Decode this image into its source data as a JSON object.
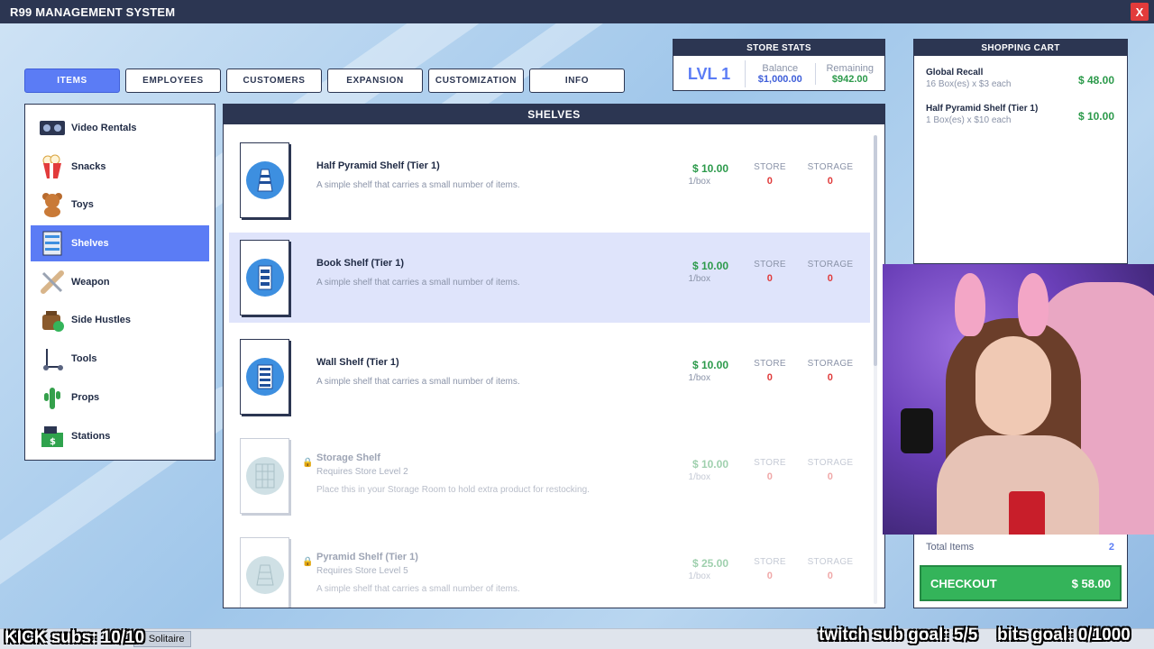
{
  "window": {
    "title": "R99 MANAGEMENT SYSTEM",
    "close_label": "X"
  },
  "tabs": [
    {
      "label": "ITEMS",
      "active": true
    },
    {
      "label": "EMPLOYEES",
      "active": false
    },
    {
      "label": "CUSTOMERS",
      "active": false
    },
    {
      "label": "EXPANSION",
      "active": false
    },
    {
      "label": "CUSTOMIZATION",
      "active": false
    },
    {
      "label": "INFO",
      "active": false
    }
  ],
  "store_stats": {
    "header": "STORE STATS",
    "level": "LVL 1",
    "balance_label": "Balance",
    "balance_value": "$1,000.00",
    "remaining_label": "Remaining",
    "remaining_value": "$942.00"
  },
  "sidebar": {
    "items": [
      {
        "label": "Video Rentals",
        "icon": "video-tape-icon"
      },
      {
        "label": "Snacks",
        "icon": "popcorn-icon"
      },
      {
        "label": "Toys",
        "icon": "teddy-bear-icon"
      },
      {
        "label": "Shelves",
        "icon": "shelf-icon",
        "active": true
      },
      {
        "label": "Weapon",
        "icon": "bat-icon"
      },
      {
        "label": "Side Hustles",
        "icon": "money-bag-icon"
      },
      {
        "label": "Tools",
        "icon": "scooter-icon"
      },
      {
        "label": "Props",
        "icon": "cactus-icon"
      },
      {
        "label": "Stations",
        "icon": "cash-register-icon"
      }
    ]
  },
  "panel": {
    "header": "SHELVES",
    "store_label": "STORE",
    "storage_label": "STORAGE",
    "items": [
      {
        "name": "Half Pyramid Shelf (Tier 1)",
        "desc": "A simple shelf that carries a small number of items.",
        "price": "$ 10.00",
        "unit": "1/box",
        "store": "0",
        "storage": "0",
        "locked": false
      },
      {
        "name": "Book Shelf (Tier 1)",
        "desc": "A simple shelf that carries a small number of items.",
        "price": "$ 10.00",
        "unit": "1/box",
        "store": "0",
        "storage": "0",
        "locked": false,
        "selected": true
      },
      {
        "name": "Wall Shelf (Tier 1)",
        "desc": "A simple shelf that carries a small number of items.",
        "price": "$ 10.00",
        "unit": "1/box",
        "store": "0",
        "storage": "0",
        "locked": false
      },
      {
        "name": "Storage Shelf",
        "requirement": "Requires Store Level 2",
        "desc": "Place this in your Storage Room to hold extra product for restocking.",
        "price": "$ 10.00",
        "unit": "1/box",
        "store": "0",
        "storage": "0",
        "locked": true
      },
      {
        "name": "Pyramid Shelf (Tier 1)",
        "requirement": "Requires Store Level 5",
        "desc": "A simple shelf that carries a small number of items.",
        "price": "$ 25.00",
        "unit": "1/box",
        "store": "0",
        "storage": "0",
        "locked": true
      }
    ]
  },
  "cart": {
    "header": "SHOPPING CART",
    "items": [
      {
        "name": "Global Recall",
        "qty": "16 Box(es) x $3 each",
        "price": "$ 48.00"
      },
      {
        "name": "Half Pyramid Shelf (Tier 1)",
        "qty": "1 Box(es) x $10 each",
        "price": "$ 10.00"
      }
    ],
    "total_label": "Total Items",
    "total_value": "2",
    "checkout_label": "CHECKOUT",
    "checkout_price": "$ 58.00"
  },
  "taskbar": {
    "app": "Solitaire"
  },
  "stream_overlay": {
    "kick": "KICK subs: 10/10",
    "twitch": "twitch sub goal: 5/5",
    "bits": "bits goal: 0/1000"
  },
  "colors": {
    "accent": "#5b7cf5",
    "header": "#2c3652",
    "price": "#2c9a4b",
    "stock": "#e03b3b",
    "checkout": "#34b45a"
  }
}
